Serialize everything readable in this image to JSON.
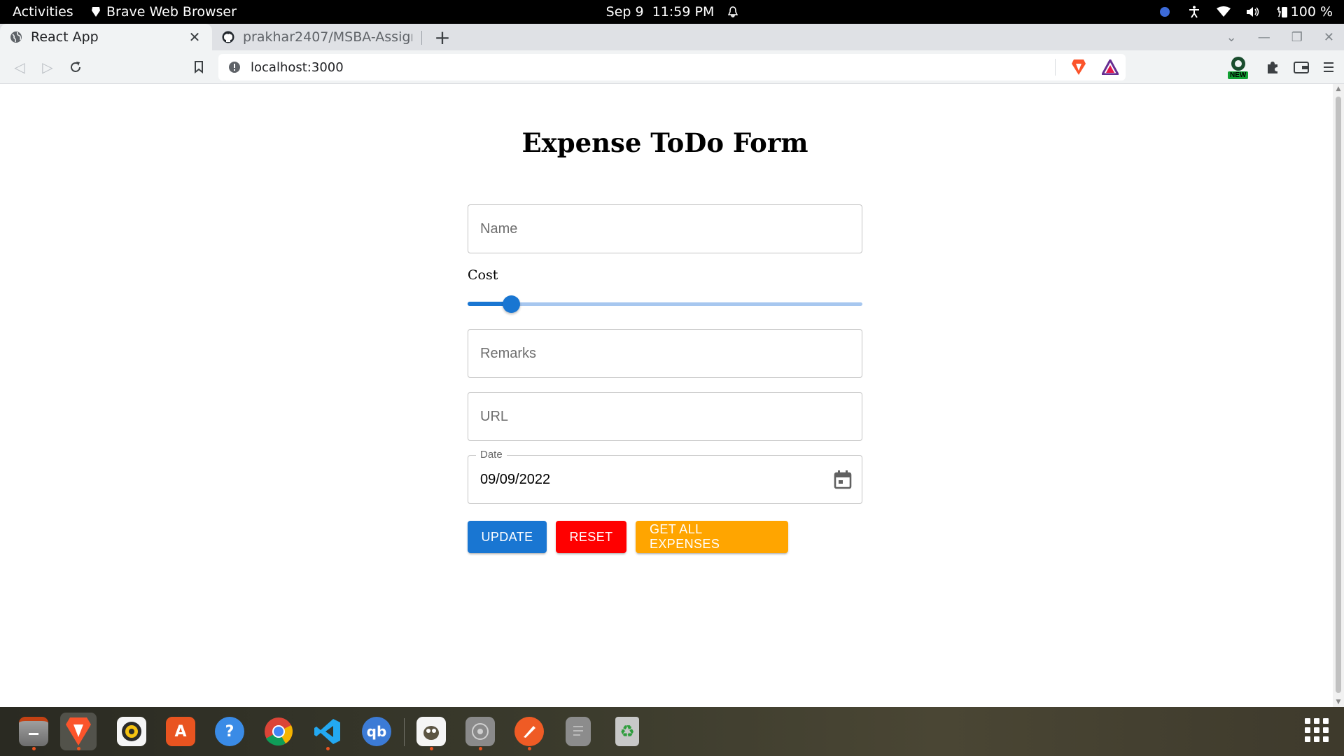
{
  "system_bar": {
    "activities": "Activities",
    "app_name": "Brave Web Browser",
    "date": "Sep 9",
    "time": "11:59 PM",
    "battery": "100 %"
  },
  "browser": {
    "tabs": [
      {
        "title": "React App",
        "active": true
      },
      {
        "title": "prakhar2407/MSBA-Assignme",
        "active": false
      }
    ],
    "new_tab": "+",
    "address": "localhost:3000",
    "new_badge": "NEW"
  },
  "page": {
    "title": "Expense ToDo Form",
    "name_placeholder": "Name",
    "cost_label": "Cost",
    "cost_slider_fraction": 0.11,
    "remarks_placeholder": "Remarks",
    "url_placeholder": "URL",
    "date_label": "Date",
    "date_value": "09/09/2022",
    "buttons": {
      "update": "UPDATE",
      "reset": "RESET",
      "get_all": "GET ALL EXPENSES"
    }
  },
  "colors": {
    "primary": "#1976d2",
    "reset": "#ff0000",
    "get_all": "#ffa500"
  },
  "dock": [
    {
      "name": "files",
      "icon": "files-icon",
      "running": true
    },
    {
      "name": "brave",
      "icon": "brave-icon",
      "running": true,
      "active": true
    },
    {
      "name": "rhythmbox",
      "icon": "rhythmbox-icon",
      "running": false
    },
    {
      "name": "software",
      "icon": "app-center-icon",
      "running": false
    },
    {
      "name": "help",
      "icon": "help-icon",
      "running": false
    },
    {
      "name": "chrome",
      "icon": "chrome-icon",
      "running": false
    },
    {
      "name": "vscode",
      "icon": "vscode-icon",
      "running": true
    },
    {
      "name": "qbittorrent",
      "icon": "qbittorrent-icon",
      "running": false
    },
    {
      "name": "gimp",
      "icon": "gimp-icon",
      "running": true
    },
    {
      "name": "disk",
      "icon": "disk-icon",
      "running": true
    },
    {
      "name": "postman",
      "icon": "postman-icon",
      "running": true
    },
    {
      "name": "text-editor",
      "icon": "text-editor-icon",
      "running": false
    },
    {
      "name": "trash",
      "icon": "trash-icon",
      "running": false
    }
  ]
}
